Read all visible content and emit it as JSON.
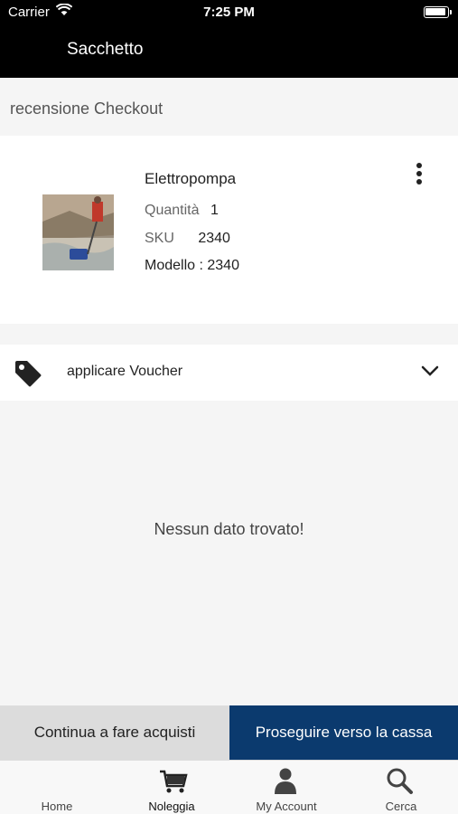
{
  "status_bar": {
    "carrier": "Carrier",
    "time": "7:25 PM"
  },
  "nav": {
    "title": "Sacchetto"
  },
  "section": {
    "title": "recensione Checkout"
  },
  "product": {
    "name": "Elettropompa",
    "quantity_label": "Quantità",
    "quantity_value": "1",
    "sku_label": "SKU",
    "sku_value": "2340",
    "model_label": "Modello :",
    "model_value": "2340"
  },
  "voucher": {
    "label": "applicare Voucher",
    "icon": "tag-icon"
  },
  "empty_message": "Nessun dato trovato!",
  "actions": {
    "continue_label": "Continua a fare acquisti",
    "checkout_label": "Proseguire verso la cassa"
  },
  "tabbar": {
    "items": [
      {
        "label": "Home",
        "icon": "home-icon"
      },
      {
        "label": "Noleggia",
        "icon": "cart-icon"
      },
      {
        "label": "My Account",
        "icon": "user-icon"
      },
      {
        "label": "Cerca",
        "icon": "search-icon"
      }
    ]
  },
  "colors": {
    "navbar": "#000000",
    "primary_button": "#0b3a6e",
    "secondary_button": "#dcdcdc"
  }
}
